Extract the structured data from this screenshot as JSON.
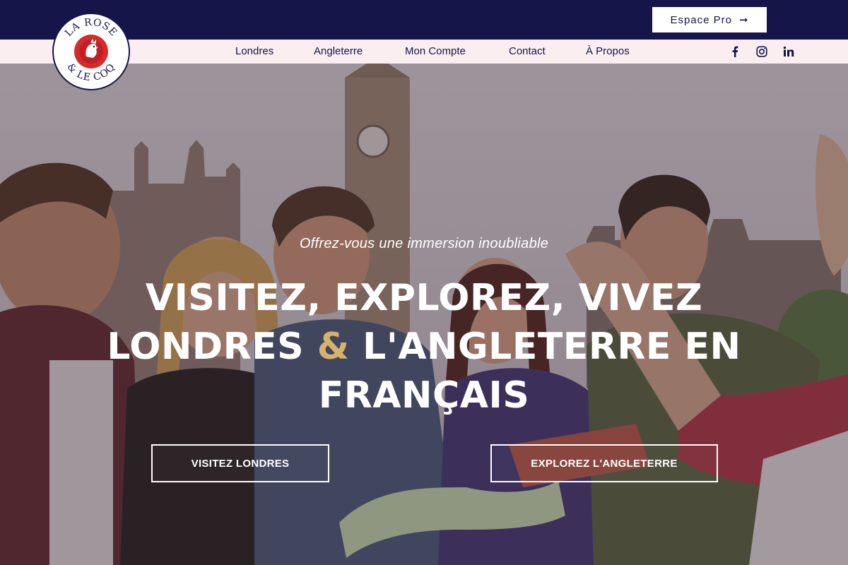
{
  "brand": {
    "logo_text_top": "LA ROSE",
    "logo_text_bottom": "& LE COQ",
    "colors": {
      "navy": "#16154a",
      "gold": "#d6b26a",
      "red": "#d62b2b",
      "pink_bar": "#fbeef0"
    }
  },
  "topbar": {
    "pro_button_label": "Espace Pro",
    "pro_button_icon": "arrow-right-icon"
  },
  "nav": {
    "items": [
      {
        "label": "Londres"
      },
      {
        "label": "Angleterre"
      },
      {
        "label": "Mon Compte"
      },
      {
        "label": "Contact"
      },
      {
        "label": "À Propos"
      }
    ],
    "social": [
      "facebook-icon",
      "instagram-icon",
      "linkedin-icon"
    ]
  },
  "hero": {
    "tagline": "Offrez-vous une immersion inoubliable",
    "headline_line1": "VISITEZ, EXPLOREZ, VIVEZ",
    "headline_line2_a": "LONDRES ",
    "headline_line2_amp": "&",
    "headline_line2_b": " L'ANGLETERRE EN",
    "headline_line3": "FRANÇAIS",
    "cta_primary": "VISITEZ LONDRES",
    "cta_secondary": "EXPLOREZ L'ANGLETERRE"
  }
}
